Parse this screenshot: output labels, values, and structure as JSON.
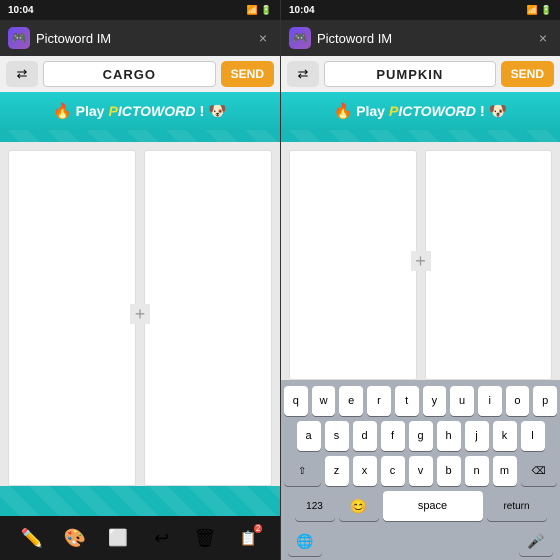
{
  "panels": [
    {
      "id": "left",
      "status": {
        "time": "10:04",
        "icons": "▲▲▲"
      },
      "header": {
        "title": "Pictoword IM",
        "icon": "🎮",
        "close_label": "×"
      },
      "input_bar": {
        "shuffle_label": "⇄",
        "word_value": "CARGO",
        "send_label": "SEND"
      },
      "banner": {
        "fire": "🔥",
        "text": "Play ",
        "logo": "PICTOWORD",
        "dog": "🐶"
      },
      "plus_label": "+",
      "toolbar": {
        "pencil": "✏️",
        "palette": "🎨",
        "eraser": "🧹",
        "undo": "↩",
        "trash": "🗑",
        "layers": "📋"
      }
    },
    {
      "id": "right",
      "status": {
        "time": "10:04",
        "icons": "▲▲▲"
      },
      "header": {
        "title": "Pictoword IM",
        "icon": "🎮",
        "close_label": "×"
      },
      "input_bar": {
        "shuffle_label": "⇄",
        "word_value": "PUMPKIN",
        "send_label": "SEND"
      },
      "banner": {
        "fire": "🔥",
        "text": "Play ",
        "logo": "PICTOWORD",
        "dog": "🐶"
      },
      "plus_label": "+",
      "keyboard": {
        "rows": [
          [
            "q",
            "w",
            "e",
            "r",
            "t",
            "y",
            "u",
            "i",
            "o",
            "p"
          ],
          [
            "a",
            "s",
            "d",
            "f",
            "g",
            "h",
            "j",
            "k",
            "l"
          ],
          [
            "z",
            "x",
            "c",
            "v",
            "b",
            "n",
            "m"
          ],
          [
            "123",
            "😊",
            "space",
            "return"
          ]
        ],
        "space_label": "space",
        "return_label": "return",
        "num_label": "123",
        "backspace_label": "⌫",
        "shift_label": "⇧",
        "globe_label": "🌐",
        "mic_label": "🎤"
      }
    }
  ]
}
